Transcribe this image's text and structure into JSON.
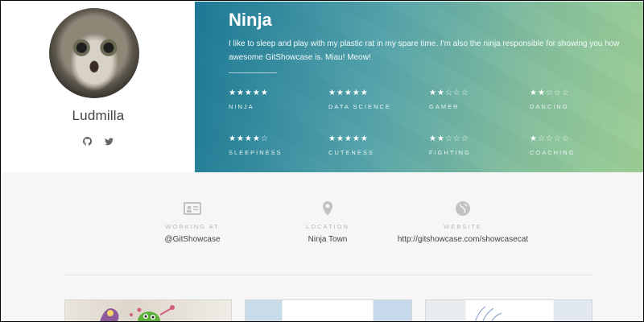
{
  "profile": {
    "name": "Ludmilla",
    "social": [
      "github-icon",
      "twitter-icon"
    ]
  },
  "hero": {
    "title": "Ninja",
    "bio": "I like to sleep and play with my plastic rat in my spare time. I'm also the ninja responsible for showing you how awesome GitShowcase is. Miau! Meow!",
    "skills": [
      {
        "label": "NINJA",
        "rating": 5,
        "stars": "★★★★★",
        "empty": ""
      },
      {
        "label": "DATA SCIENCE",
        "rating": 5,
        "stars": "★★★★★",
        "empty": ""
      },
      {
        "label": "GAMER",
        "rating": 2,
        "stars": "★★",
        "empty": "☆☆☆"
      },
      {
        "label": "DANCING",
        "rating": 2,
        "stars": "★★",
        "empty": "☆☆☆"
      },
      {
        "label": "SLEEPINESS",
        "rating": 4,
        "stars": "★★★★",
        "empty": "☆"
      },
      {
        "label": "CUTENESS",
        "rating": 5,
        "stars": "★★★★★",
        "empty": ""
      },
      {
        "label": "FIGHTING",
        "rating": 2,
        "stars": "★★",
        "empty": "☆☆☆"
      },
      {
        "label": "COACHING",
        "rating": 1,
        "stars": "★",
        "empty": "☆☆☆☆"
      }
    ]
  },
  "info": {
    "working": {
      "label": "WORKING AT",
      "value": "@GitShowcase",
      "icon": "id-card-icon"
    },
    "location": {
      "label": "LOCATION",
      "value": "Ninja Town",
      "icon": "map-pin-icon"
    },
    "website": {
      "label": "WEBSITE",
      "value": "http://gitshowcase.com/showcasecat",
      "icon": "globe-icon"
    }
  },
  "colors": {
    "hero_start": "#0a6e8c",
    "hero_end": "#78be6e",
    "background": "#f6f6f6"
  }
}
